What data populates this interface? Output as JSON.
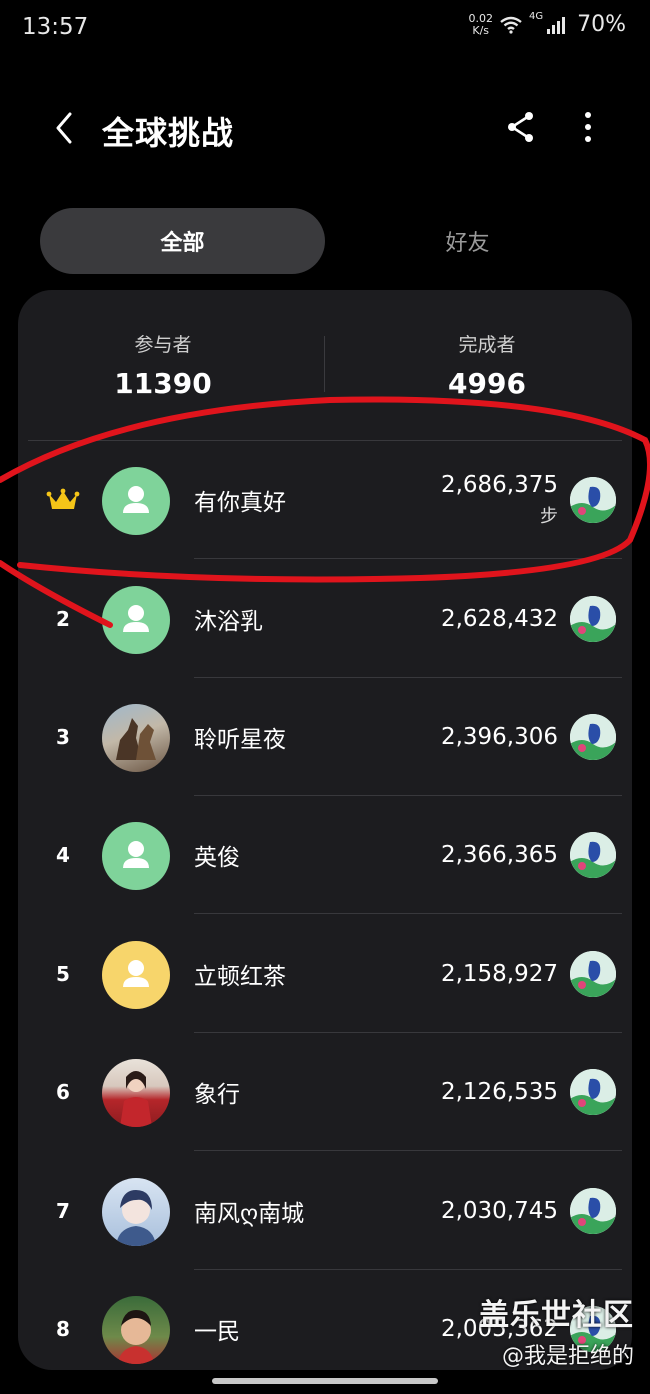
{
  "status_bar": {
    "time": "13:57",
    "net_speed_top": "0.02",
    "net_speed_unit": "K/s",
    "network": "4G",
    "battery": "70%"
  },
  "header": {
    "title": "全球挑战",
    "icons": [
      "back-arrow-icon",
      "share-icon",
      "more-vert-icon"
    ]
  },
  "tabs": [
    {
      "label": "全部",
      "active": true
    },
    {
      "label": "好友",
      "active": false
    }
  ],
  "stats": {
    "participants_label": "参与者",
    "participants_value": "11390",
    "finishers_label": "完成者",
    "finishers_value": "4996"
  },
  "leaderboard": [
    {
      "rank": "",
      "rank_icon": "crown-icon",
      "name": "有你真好",
      "steps": "2,686,375",
      "unit": "步",
      "avatar": "default-green"
    },
    {
      "rank": "2",
      "name": "沐浴乳",
      "steps": "2,628,432",
      "avatar": "default-green"
    },
    {
      "rank": "3",
      "name": "聆听星夜",
      "steps": "2,396,306",
      "avatar": "photo-horses"
    },
    {
      "rank": "4",
      "name": "英俊",
      "steps": "2,366,365",
      "avatar": "default-green"
    },
    {
      "rank": "5",
      "name": "立顿红茶",
      "steps": "2,158,927",
      "avatar": "default-yellow"
    },
    {
      "rank": "6",
      "name": "象行",
      "steps": "2,126,535",
      "avatar": "photo-red-dress"
    },
    {
      "rank": "7",
      "name": "南风ღ南城",
      "steps": "2,030,745",
      "avatar": "photo-anime-boy"
    },
    {
      "rank": "8",
      "name": "一民",
      "steps": "2,005,362",
      "avatar": "photo-child"
    }
  ],
  "colors": {
    "avatar_green": "#7fd39a",
    "avatar_yellow": "#f7d56b",
    "crown": "#f5c518",
    "annotation": "#e0141c"
  },
  "watermark": {
    "line1": "盖乐世社区",
    "line2": "@我是拒绝的"
  }
}
